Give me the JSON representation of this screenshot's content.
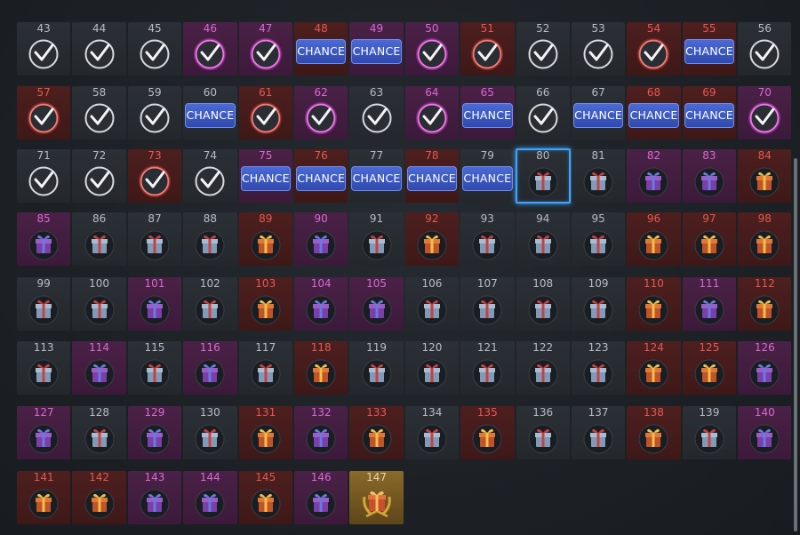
{
  "chance_label": "CHANCE",
  "colors": {
    "grey_text": "#b8bcc2",
    "purple_text": "#d66ad0",
    "red_text": "#e05a50",
    "gold_text": "#e8d8a8",
    "chance_button": "#3a57c4",
    "selection": "#3ea4ff"
  },
  "rows": [
    [
      {
        "n": "43",
        "rarity": "grey",
        "state": "done"
      },
      {
        "n": "44",
        "rarity": "grey",
        "state": "done"
      },
      {
        "n": "45",
        "rarity": "grey",
        "state": "done"
      },
      {
        "n": "46",
        "rarity": "purple",
        "state": "done"
      },
      {
        "n": "47",
        "rarity": "purple",
        "state": "done"
      },
      {
        "n": "48",
        "rarity": "red",
        "state": "chance"
      },
      {
        "n": "49",
        "rarity": "purple",
        "state": "chance"
      },
      {
        "n": "50",
        "rarity": "purple",
        "state": "done"
      },
      {
        "n": "51",
        "rarity": "red",
        "state": "done"
      },
      {
        "n": "52",
        "rarity": "grey",
        "state": "done"
      },
      {
        "n": "53",
        "rarity": "grey",
        "state": "done"
      },
      {
        "n": "54",
        "rarity": "red",
        "state": "done"
      },
      {
        "n": "55",
        "rarity": "red",
        "state": "chance"
      },
      {
        "n": "56",
        "rarity": "grey",
        "state": "done"
      }
    ],
    [
      {
        "n": "57",
        "rarity": "red",
        "state": "done"
      },
      {
        "n": "58",
        "rarity": "grey",
        "state": "done"
      },
      {
        "n": "59",
        "rarity": "grey",
        "state": "done"
      },
      {
        "n": "60",
        "rarity": "grey",
        "state": "chance"
      },
      {
        "n": "61",
        "rarity": "red",
        "state": "done"
      },
      {
        "n": "62",
        "rarity": "purple",
        "state": "done"
      },
      {
        "n": "63",
        "rarity": "grey",
        "state": "done"
      },
      {
        "n": "64",
        "rarity": "purple",
        "state": "done"
      },
      {
        "n": "65",
        "rarity": "purple",
        "state": "chance"
      },
      {
        "n": "66",
        "rarity": "grey",
        "state": "done"
      },
      {
        "n": "67",
        "rarity": "grey",
        "state": "chance"
      },
      {
        "n": "68",
        "rarity": "red",
        "state": "chance"
      },
      {
        "n": "69",
        "rarity": "red",
        "state": "chance"
      },
      {
        "n": "70",
        "rarity": "purple",
        "state": "done"
      }
    ],
    [
      {
        "n": "71",
        "rarity": "grey",
        "state": "done"
      },
      {
        "n": "72",
        "rarity": "grey",
        "state": "done"
      },
      {
        "n": "73",
        "rarity": "red",
        "state": "done"
      },
      {
        "n": "74",
        "rarity": "grey",
        "state": "done"
      },
      {
        "n": "75",
        "rarity": "purple",
        "state": "chance"
      },
      {
        "n": "76",
        "rarity": "red",
        "state": "chance"
      },
      {
        "n": "77",
        "rarity": "grey",
        "state": "chance"
      },
      {
        "n": "78",
        "rarity": "red",
        "state": "chance"
      },
      {
        "n": "79",
        "rarity": "grey",
        "state": "chance"
      },
      {
        "n": "80",
        "rarity": "grey",
        "state": "gift",
        "selected": true
      },
      {
        "n": "81",
        "rarity": "grey",
        "state": "gift"
      },
      {
        "n": "82",
        "rarity": "purple",
        "state": "gift"
      },
      {
        "n": "83",
        "rarity": "purple",
        "state": "gift"
      },
      {
        "n": "84",
        "rarity": "red",
        "state": "gift"
      }
    ],
    [
      {
        "n": "85",
        "rarity": "purple",
        "state": "gift"
      },
      {
        "n": "86",
        "rarity": "grey",
        "state": "gift"
      },
      {
        "n": "87",
        "rarity": "grey",
        "state": "gift"
      },
      {
        "n": "88",
        "rarity": "grey",
        "state": "gift"
      },
      {
        "n": "89",
        "rarity": "red",
        "state": "gift"
      },
      {
        "n": "90",
        "rarity": "purple",
        "state": "gift"
      },
      {
        "n": "91",
        "rarity": "grey",
        "state": "gift"
      },
      {
        "n": "92",
        "rarity": "red",
        "state": "gift"
      },
      {
        "n": "93",
        "rarity": "grey",
        "state": "gift"
      },
      {
        "n": "94",
        "rarity": "grey",
        "state": "gift"
      },
      {
        "n": "95",
        "rarity": "grey",
        "state": "gift"
      },
      {
        "n": "96",
        "rarity": "red",
        "state": "gift"
      },
      {
        "n": "97",
        "rarity": "red",
        "state": "gift"
      },
      {
        "n": "98",
        "rarity": "red",
        "state": "gift"
      }
    ],
    [
      {
        "n": "99",
        "rarity": "grey",
        "state": "gift"
      },
      {
        "n": "100",
        "rarity": "grey",
        "state": "gift"
      },
      {
        "n": "101",
        "rarity": "purple",
        "state": "gift"
      },
      {
        "n": "102",
        "rarity": "grey",
        "state": "gift"
      },
      {
        "n": "103",
        "rarity": "red",
        "state": "gift"
      },
      {
        "n": "104",
        "rarity": "purple",
        "state": "gift"
      },
      {
        "n": "105",
        "rarity": "purple",
        "state": "gift"
      },
      {
        "n": "106",
        "rarity": "grey",
        "state": "gift"
      },
      {
        "n": "107",
        "rarity": "grey",
        "state": "gift"
      },
      {
        "n": "108",
        "rarity": "grey",
        "state": "gift"
      },
      {
        "n": "109",
        "rarity": "grey",
        "state": "gift"
      },
      {
        "n": "110",
        "rarity": "red",
        "state": "gift"
      },
      {
        "n": "111",
        "rarity": "purple",
        "state": "gift"
      },
      {
        "n": "112",
        "rarity": "red",
        "state": "gift"
      }
    ],
    [
      {
        "n": "113",
        "rarity": "grey",
        "state": "gift"
      },
      {
        "n": "114",
        "rarity": "purple",
        "state": "gift"
      },
      {
        "n": "115",
        "rarity": "grey",
        "state": "gift"
      },
      {
        "n": "116",
        "rarity": "purple",
        "state": "gift"
      },
      {
        "n": "117",
        "rarity": "grey",
        "state": "gift"
      },
      {
        "n": "118",
        "rarity": "red",
        "state": "gift"
      },
      {
        "n": "119",
        "rarity": "grey",
        "state": "gift"
      },
      {
        "n": "120",
        "rarity": "grey",
        "state": "gift"
      },
      {
        "n": "121",
        "rarity": "grey",
        "state": "gift"
      },
      {
        "n": "122",
        "rarity": "grey",
        "state": "gift"
      },
      {
        "n": "123",
        "rarity": "grey",
        "state": "gift"
      },
      {
        "n": "124",
        "rarity": "red",
        "state": "gift"
      },
      {
        "n": "125",
        "rarity": "red",
        "state": "gift"
      },
      {
        "n": "126",
        "rarity": "purple",
        "state": "gift"
      }
    ],
    [
      {
        "n": "127",
        "rarity": "purple",
        "state": "gift"
      },
      {
        "n": "128",
        "rarity": "grey",
        "state": "gift"
      },
      {
        "n": "129",
        "rarity": "purple",
        "state": "gift"
      },
      {
        "n": "130",
        "rarity": "grey",
        "state": "gift"
      },
      {
        "n": "131",
        "rarity": "red",
        "state": "gift"
      },
      {
        "n": "132",
        "rarity": "purple",
        "state": "gift"
      },
      {
        "n": "133",
        "rarity": "red",
        "state": "gift"
      },
      {
        "n": "134",
        "rarity": "grey",
        "state": "gift"
      },
      {
        "n": "135",
        "rarity": "red",
        "state": "gift"
      },
      {
        "n": "136",
        "rarity": "grey",
        "state": "gift"
      },
      {
        "n": "137",
        "rarity": "grey",
        "state": "gift"
      },
      {
        "n": "138",
        "rarity": "red",
        "state": "gift"
      },
      {
        "n": "139",
        "rarity": "grey",
        "state": "gift"
      },
      {
        "n": "140",
        "rarity": "purple",
        "state": "gift"
      }
    ],
    [
      {
        "n": "141",
        "rarity": "red",
        "state": "gift"
      },
      {
        "n": "142",
        "rarity": "red",
        "state": "gift"
      },
      {
        "n": "143",
        "rarity": "purple",
        "state": "gift"
      },
      {
        "n": "144",
        "rarity": "purple",
        "state": "gift"
      },
      {
        "n": "145",
        "rarity": "red",
        "state": "gift"
      },
      {
        "n": "146",
        "rarity": "purple",
        "state": "gift"
      },
      {
        "n": "147",
        "rarity": "gold",
        "state": "grand"
      }
    ]
  ]
}
